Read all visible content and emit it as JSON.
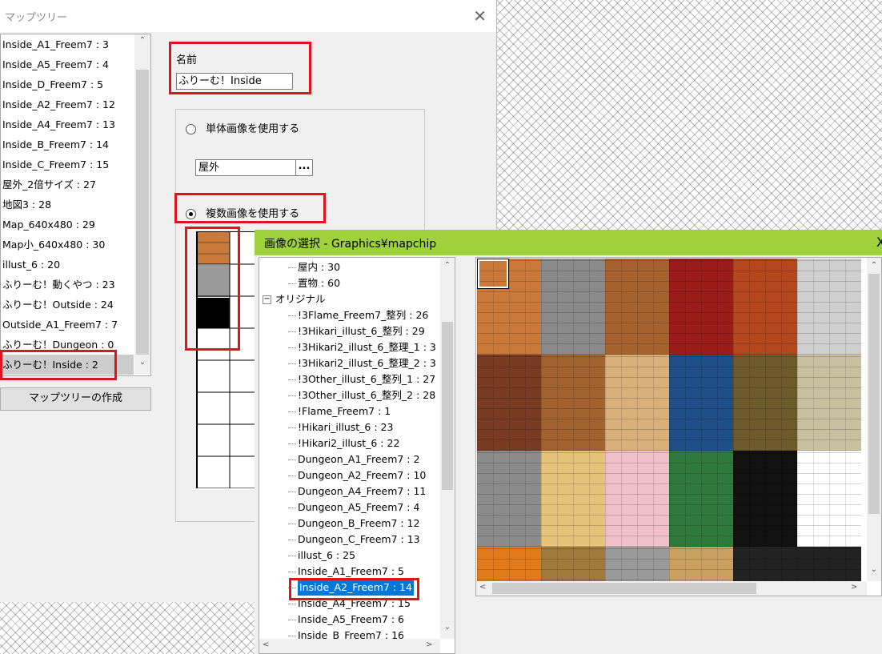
{
  "main_dialog": {
    "title": "マップツリー",
    "close_glyph": "✕",
    "map_list": [
      "Inside_A1_Freem7 : 3",
      "Inside_A5_Freem7 : 4",
      "Inside_D_Freem7 : 5",
      "Inside_A2_Freem7 : 12",
      "Inside_A4_Freem7 : 13",
      "Inside_B_Freem7 : 14",
      "Inside_C_Freem7 : 15",
      "屋外_2倍サイズ : 27",
      "地図3 : 28",
      "Map_640x480 : 29",
      "Map小_640x480 : 30",
      "illust_6 : 20",
      "ふりーむ！動くやつ : 23",
      "ふりーむ！Outside : 24",
      "Outside_A1_Freem7 : 7",
      "ふりーむ！Dungeon : 0",
      "ふりーむ！Inside : 2"
    ],
    "selected_index": 16,
    "create_button": "マップツリーの作成",
    "name_label": "名前",
    "name_value": "ふりーむ！Inside",
    "single_image_label": "単体画像を使用する",
    "single_image_value": "屋外",
    "browse_label": "...",
    "multi_image_label": "複数画像を使用する",
    "single_selected": false,
    "multi_selected": true
  },
  "image_dialog": {
    "title": "画像の選択 - Graphics¥mapchip",
    "close_glyph": "X",
    "tree": [
      {
        "label": "屋内 : 30",
        "level": 2
      },
      {
        "label": "置物 : 60",
        "level": 2
      },
      {
        "label": "オリジナル",
        "level": 1,
        "expander": "−"
      },
      {
        "label": "!3Flame_Freem7_整列 : 26",
        "level": 2
      },
      {
        "label": "!3Hikari_illust_6_整列 : 29",
        "level": 2
      },
      {
        "label": "!3Hikari2_illust_6_整理_1 : 3",
        "level": 2
      },
      {
        "label": "!3Hikari2_illust_6_整理_2 : 3",
        "level": 2
      },
      {
        "label": "!3Other_illust_6_整列_1 : 27",
        "level": 2
      },
      {
        "label": "!3Other_illust_6_整列_2 : 28",
        "level": 2
      },
      {
        "label": "!Flame_Freem7 : 1",
        "level": 2
      },
      {
        "label": "!Hikari_illust_6 : 23",
        "level": 2
      },
      {
        "label": "!Hikari2_illust_6 : 22",
        "level": 2
      },
      {
        "label": "Dungeon_A1_Freem7 : 2",
        "level": 2
      },
      {
        "label": "Dungeon_A2_Freem7 : 10",
        "level": 2
      },
      {
        "label": "Dungeon_A4_Freem7 : 11",
        "level": 2
      },
      {
        "label": "Dungeon_A5_Freem7 : 4",
        "level": 2
      },
      {
        "label": "Dungeon_B_Freem7 : 12",
        "level": 2
      },
      {
        "label": "Dungeon_C_Freem7 : 13",
        "level": 2
      },
      {
        "label": "illust_6 : 25",
        "level": 2
      },
      {
        "label": "Inside_A1_Freem7 : 5",
        "level": 2
      },
      {
        "label": "Inside_A2_Freem7 : 14",
        "level": 2,
        "selected": true
      },
      {
        "label": "Inside_A4_Freem7 : 15",
        "level": 2
      },
      {
        "label": "Inside_A5_Freem7 : 6",
        "level": 2
      },
      {
        "label": "Inside_B_Freem7 : 16",
        "level": 2
      }
    ],
    "tile_colors": [
      "#c97a3a",
      "#8a8a8a",
      "#a5612e",
      "#9b1a1a",
      "#b5471e",
      "#cfcfcf",
      "#7a3b25",
      "#a0622f",
      "#d9b07a",
      "#1f4f86",
      "#6e5a2a",
      "#c9c0a0",
      "#8c8c8c",
      "#e6c37a",
      "#f0c0c8",
      "#2f7a3a",
      "#111111",
      "#ffffff",
      "#e07a1a",
      "#a07a3a",
      "#9a9a9a",
      "#c9a060",
      "#222222",
      "#222222"
    ]
  },
  "scroll_arrows": {
    "up": "⌃",
    "down": "⌄",
    "left": "<",
    "right": ">"
  }
}
